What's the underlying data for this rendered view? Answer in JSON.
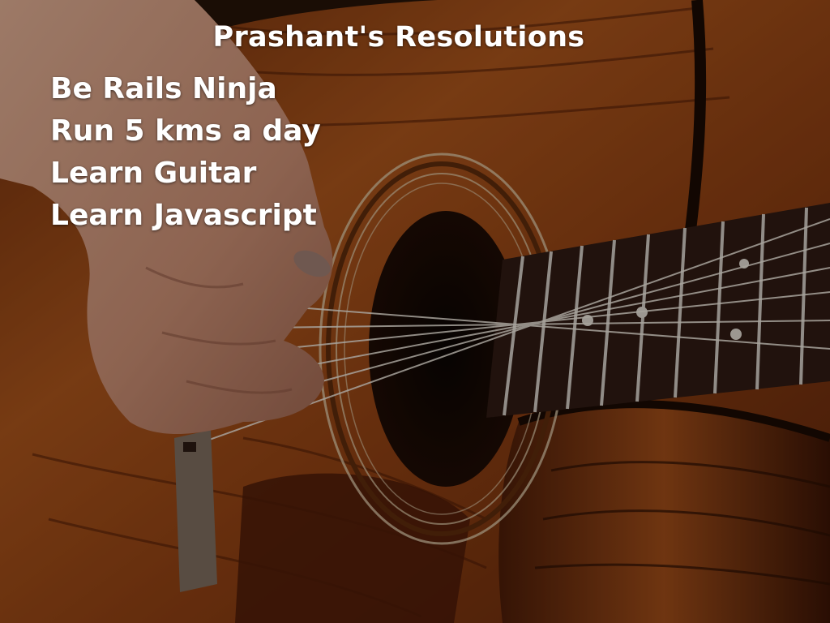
{
  "slide": {
    "title": "Prashant's Resolutions",
    "resolutions": [
      "Be Rails Ninja",
      "Run 5 kms a day",
      "Learn Guitar",
      "Learn Javascript"
    ]
  },
  "colors": {
    "text": "#ffffff",
    "wood": "#8a3e12",
    "fretboard": "#2e1a12"
  },
  "background": {
    "icon": "acoustic-guitar-photo"
  }
}
